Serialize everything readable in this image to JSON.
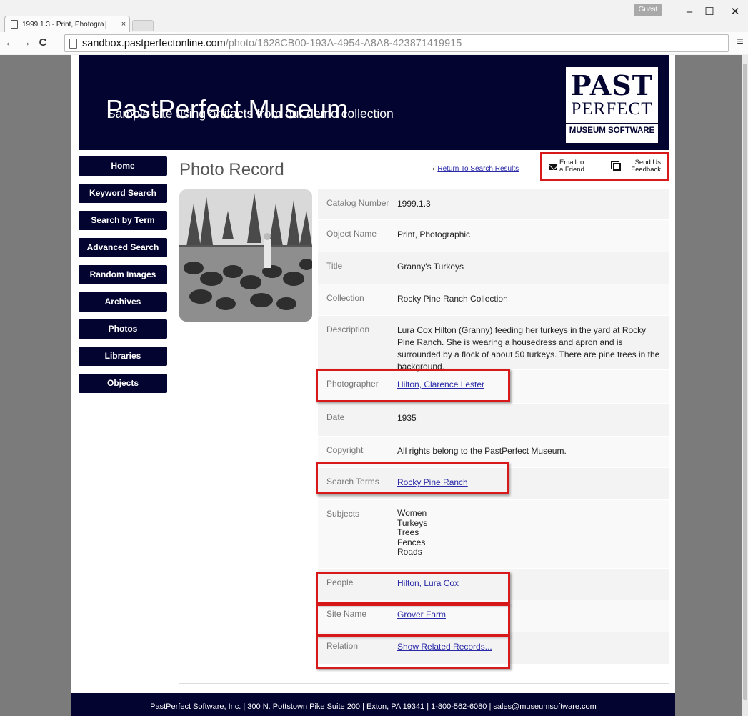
{
  "browser": {
    "tab_title": "1999.1.3 - Print, Photogra│",
    "tab_close": "×",
    "profile_label": "Guest",
    "window_controls": {
      "minimize": "–",
      "maximize": "☐",
      "close": "✕"
    },
    "nav": {
      "back": "←",
      "forward": "→",
      "reload": "C"
    },
    "url_host": "sandbox.pastperfectonline.com",
    "url_path": "/photo/1628CB00-193A-4954-A8A8-423871419915",
    "menu_icon": "≡"
  },
  "header": {
    "title": "PastPerfect Museum",
    "subtitle": "Sample site using artifacts from our demo collection",
    "logo": {
      "line1": "PAST",
      "line2": "PERFECT",
      "line3": "MUSEUM SOFTWARE"
    }
  },
  "nav": {
    "items": [
      {
        "label": "Home"
      },
      {
        "label": "Keyword Search"
      },
      {
        "label": "Search by Term"
      },
      {
        "label": "Advanced Search"
      },
      {
        "label": "Random Images"
      },
      {
        "label": "Archives"
      },
      {
        "label": "Photos"
      },
      {
        "label": "Libraries"
      },
      {
        "label": "Objects"
      }
    ]
  },
  "content": {
    "title": "Photo Record",
    "return_link": "Return To Search Results",
    "email_friend": "Email to a Friend",
    "feedback": "Send Us Feedback",
    "rows": [
      {
        "label": "Catalog Number",
        "value": "1999.1.3"
      },
      {
        "label": "Object Name",
        "value": "Print, Photographic"
      },
      {
        "label": "Title",
        "value": "Granny's Turkeys"
      },
      {
        "label": "Collection",
        "value": "Rocky Pine Ranch Collection"
      },
      {
        "label": "Description",
        "value": "Lura Cox Hilton (Granny) feeding her turkeys in the yard at Rocky Pine Ranch. She is wearing a housedress and apron and is surrounded by a flock of about 50 turkeys. There are pine trees in the background."
      },
      {
        "label": "Photographer",
        "value": "Hilton, Clarence Lester"
      },
      {
        "label": "Date",
        "value": "1935"
      },
      {
        "label": "Copyright",
        "value": "All rights belong to the PastPerfect Museum."
      },
      {
        "label": "Search Terms",
        "value": "Rocky Pine Ranch"
      },
      {
        "label": "Subjects",
        "value": [
          "Women",
          "Turkeys",
          "Trees",
          "Fences",
          "Roads"
        ]
      },
      {
        "label": "People",
        "value": "Hilton, Lura Cox"
      },
      {
        "label": "Site Name",
        "value": "Grover Farm"
      },
      {
        "label": "Relation",
        "value": "Show Related Records..."
      }
    ]
  },
  "footer": {
    "text": "PastPerfect Software, Inc. | 300 N. Pottstown Pike Suite 200 | Exton, PA 19341 | 1-800-562-6080 | sales@museumsoftware.com"
  },
  "colors": {
    "navy": "#030430",
    "highlight": "#d71919",
    "link": "#2a2aa8"
  }
}
